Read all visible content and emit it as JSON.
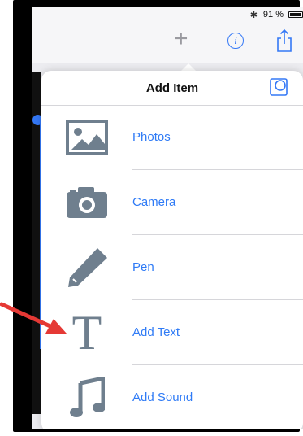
{
  "status_bar": {
    "bluetooth_symbol": "✱",
    "battery_percent": "91 %",
    "battery_level": 0.91
  },
  "nav": {
    "add_icon": "plus-icon",
    "info_icon": "info-icon",
    "info_glyph": "i",
    "share_icon": "share-icon",
    "accent_color": "#3478f6"
  },
  "popover": {
    "title": "Add Item",
    "shapes_icon": "shapes-icon",
    "items": [
      {
        "label": "Photos",
        "icon": "photo-icon"
      },
      {
        "label": "Camera",
        "icon": "camera-icon"
      },
      {
        "label": "Pen",
        "icon": "pen-icon"
      },
      {
        "label": "Add Text",
        "icon": "text-icon",
        "glyph": "T"
      },
      {
        "label": "Add Sound",
        "icon": "music-note-icon"
      }
    ],
    "icon_color": "#6f7f8e",
    "label_color": "#2f7bf6"
  },
  "annotation": {
    "arrow_color": "#e53935",
    "points_to": "Add Text"
  }
}
